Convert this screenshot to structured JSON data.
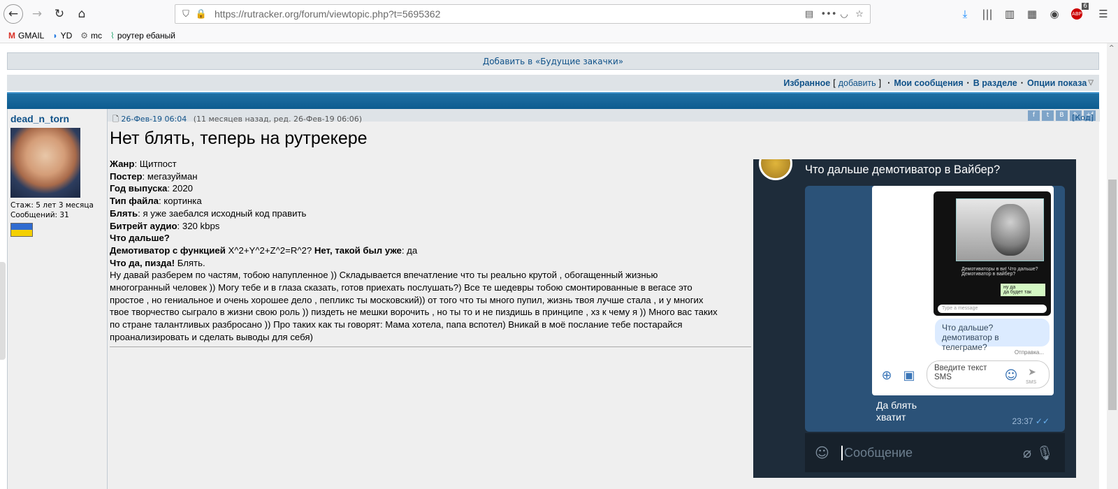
{
  "browser": {
    "url_prefix": "https://rutracker.org",
    "url_path": "/forum/viewtopic.php?t=5695362",
    "badge_count": "6",
    "bookmarks": [
      {
        "label": "GMAIL",
        "icon": "gmail-icon"
      },
      {
        "label": "YD",
        "icon": "yandex-disk-icon"
      },
      {
        "label": "mc",
        "icon": "gear-icon"
      },
      {
        "label": "роутер ебаный",
        "icon": "router-icon"
      }
    ]
  },
  "page": {
    "future_link": "Добавить в «Будущие закачки»",
    "menu": {
      "favorites": "Избранное",
      "bracket_open": "[",
      "add": "добавить",
      "bracket_close": "]",
      "sep": "·",
      "my_messages": "Мои сообщения",
      "in_section": "В разделе",
      "view_options": "Опции показа"
    },
    "share_buttons": [
      "f",
      "t",
      "B",
      "✎",
      "+f"
    ]
  },
  "post": {
    "author": "dead_n_torn",
    "seniority": "Стаж: 5 лет 3 месяца",
    "messages": "Сообщений: 31",
    "date": "26-Фев-19 06:04",
    "edited": "(11 месяцев назад, ред. 26-Фев-19 06:06)",
    "code": "[Код]",
    "title": "Нет блять, теперь на рутрекере",
    "fields": [
      {
        "label": "Жанр",
        "value": ": Щитпост"
      },
      {
        "label": "Постер",
        "value": ": мегазуйман"
      },
      {
        "label": "Год выпуска",
        "value": ": 2020"
      },
      {
        "label": "Тип файла",
        "value": ": кортинка"
      },
      {
        "label": "Блять",
        "value": ": я уже заебался исходный код править"
      },
      {
        "label": "Битрейт аудио",
        "value": ": 320 kbps"
      },
      {
        "label": "Что дальше?",
        "value": ""
      }
    ],
    "demotivator_label": "Демотиватор с функцией",
    "demotivator_formula": " X^2+Y^2+Z^2=R^2? ",
    "demotivator_label2": "Нет, такой был уже",
    "demotivator_value": ": да",
    "what_yes_label": "Что да, пизда!",
    "what_yes_value": " Блять.",
    "body_lines": [
      "Ну давай разберем по частям, тобою напупленное )) Складывается впечатление что ты реально крутой , обогащенный жизнью",
      "многогранный человек )) Могу тебе и в глаза сказать, готов приехать послушать?) Все те шедевры тобою смонтированные в вегасе это",
      "простое , но гениальное и очень хорошее дело , пепликс ты московский)) от того что ты много пупил, жизнь твоя лучше стала , и у многих",
      "твое творчество сыграло в жизни свою роль )) пиздеть не мешки ворочить , но ты то и не пиздишь в принципе , хз к чему я )) Много вас таких",
      "по стране талантливых разбросано )) Про таких как ты говорят: Мама хотела, папа вспотел) Вникай в моё послание тебе постарайся",
      "проанализировать и сделать выводы для себя)"
    ]
  },
  "chat": {
    "title": "Что дальше демотиватор в Вайбер?",
    "mini_caption": "Демотиваторы в ви! Что дальше? Демотиватор в вайбер?",
    "mini_reply": "ну да\nда будет так",
    "mini_input": "Type a message",
    "bubble": "Что дальше?\nдемотиватор в телеграме?",
    "sent": "Отправка...",
    "sms_placeholder": "Введите текст\nSMS",
    "sms_label": "SMS",
    "message": "Да блять\nхватит",
    "time": "23:37",
    "input_placeholder": "Сообщение"
  }
}
